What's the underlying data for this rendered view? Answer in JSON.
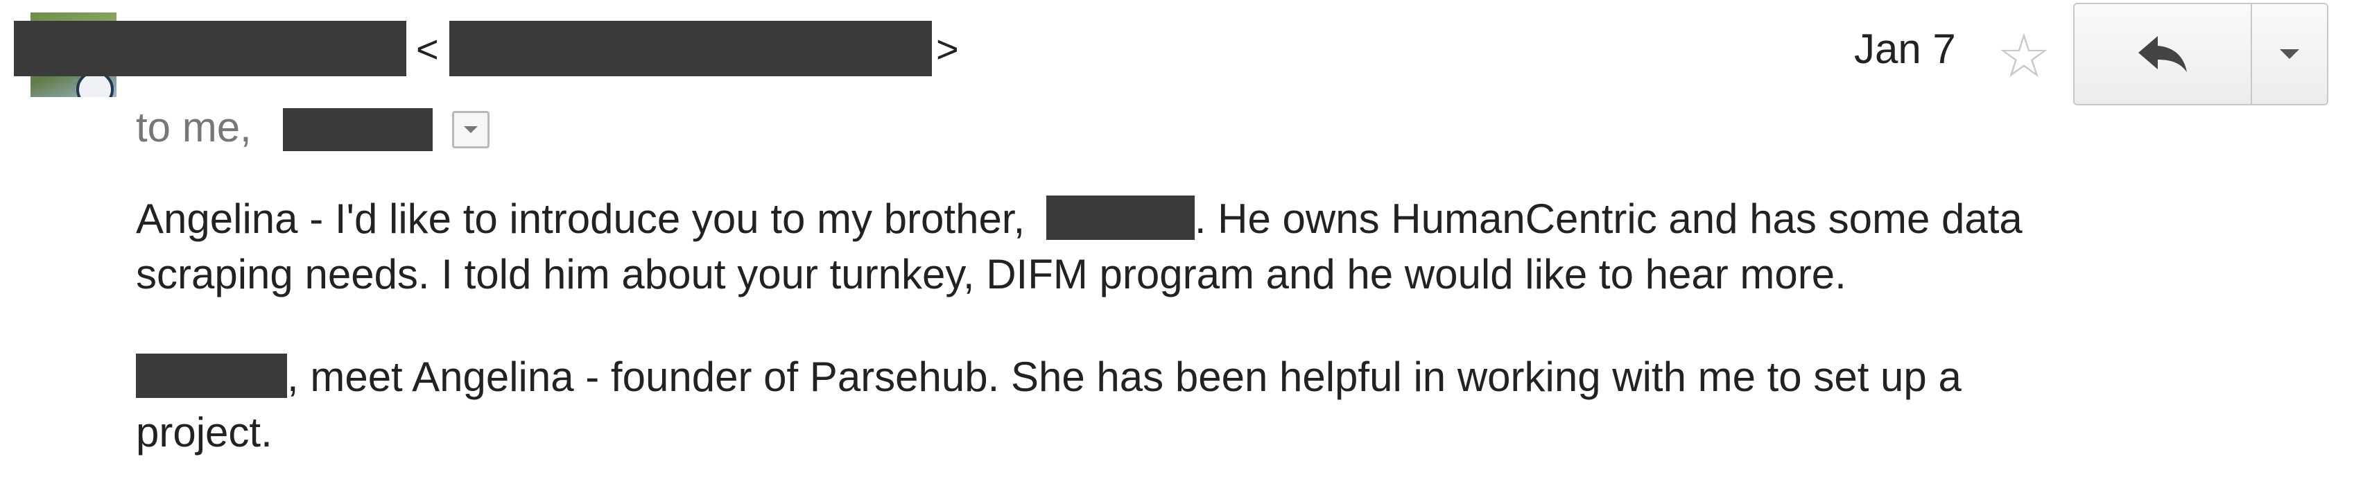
{
  "message": {
    "sender_open_bracket": "<",
    "sender_close_bracket": ">",
    "date": "Jan 7",
    "to_label": "to me,",
    "body": {
      "p1_line1_before": "Angelina - I'd like to introduce you to my brother,",
      "p1_line1_after": ". He owns HumanCentric and has some data",
      "p1_line2": "scraping needs. I told him about your turnkey, DIFM program and he would like to hear more.",
      "p2_line1_after": ", meet Angelina - founder of Parsehub. She has been helpful in working with me to set up a",
      "p2_line2": "project."
    }
  },
  "icons": {
    "star": "star-icon",
    "reply": "reply-icon",
    "more": "chevron-down-icon",
    "recipients_toggle": "chevron-down-icon"
  },
  "colors": {
    "redaction": "#3a3a3a",
    "muted_text": "#777777",
    "star_outline": "#c9c9c9"
  }
}
